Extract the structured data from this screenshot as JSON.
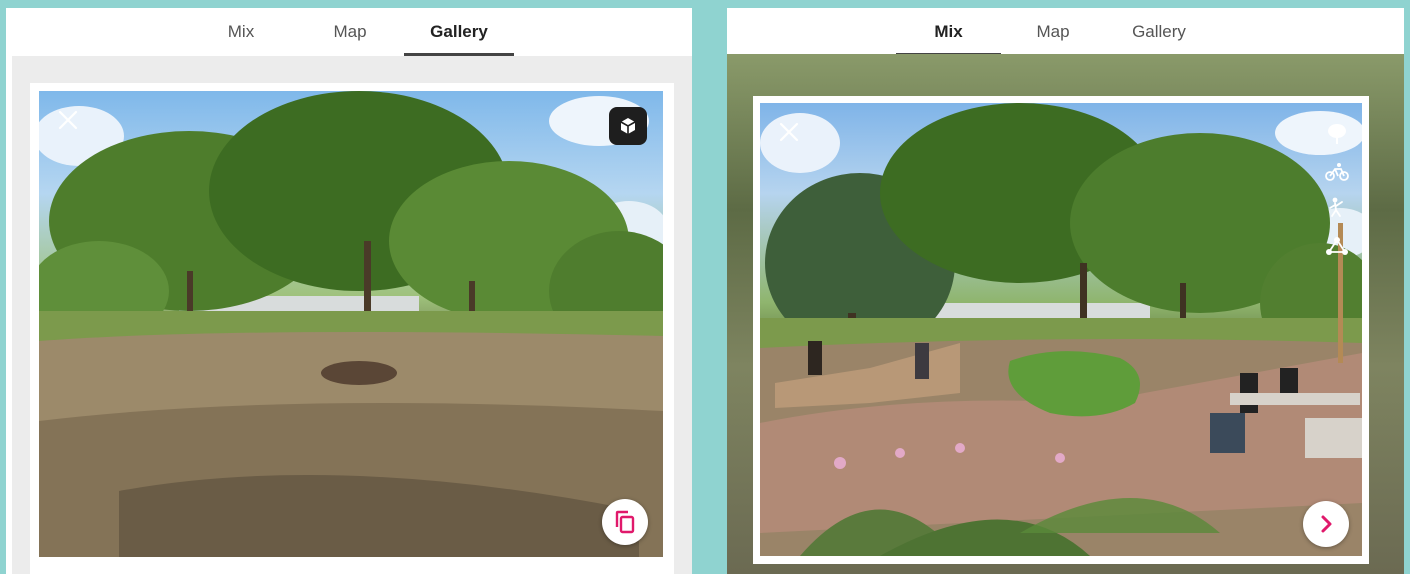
{
  "colors": {
    "frame_background": "#8fd3d0",
    "accent_pink": "#e0196b",
    "active_tab_underline": "#444444"
  },
  "left_view": {
    "tabs": [
      {
        "label": "Mix",
        "active": false
      },
      {
        "label": "Map",
        "active": false
      },
      {
        "label": "Gallery",
        "active": true
      }
    ],
    "photo": {
      "scene": "existing-site-photo",
      "close_icon": "close-icon",
      "top_right_icon": "cube-3d-icon",
      "bottom_right_icon": "copy-icon"
    }
  },
  "right_view": {
    "tabs": [
      {
        "label": "Mix",
        "active": true
      },
      {
        "label": "Map",
        "active": false
      },
      {
        "label": "Gallery",
        "active": false
      }
    ],
    "photo": {
      "scene": "proposed-design-render",
      "close_icon": "close-icon",
      "side_icons": [
        "tree-icon",
        "bicycle-icon",
        "climbing-person-icon",
        "network-icon"
      ],
      "bottom_right_icon": "chevron-right-icon"
    }
  }
}
